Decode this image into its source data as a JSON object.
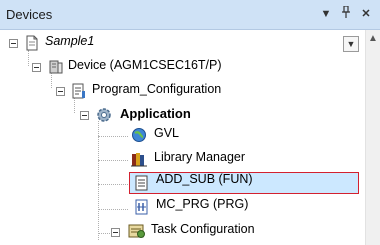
{
  "panel": {
    "title": "Devices",
    "dropdown_icon": "chevron-down-icon",
    "pin_icon": "pin-icon",
    "close_icon": "close-icon"
  },
  "tree": {
    "project": "Sample1",
    "device": "Device (AGM1CSEC16T/P)",
    "program_configuration": "Program_Configuration",
    "application": "Application",
    "gvl": "GVL",
    "library_manager": "Library Manager",
    "add_sub": "ADD_SUB (FUN)",
    "mc_prg": "MC_PRG (PRG)",
    "task_configuration": "Task Configuration"
  },
  "colors": {
    "selection_fill": "#cce8ff",
    "selection_border": "#d3212f",
    "titlebar": "#cfe2f6"
  }
}
